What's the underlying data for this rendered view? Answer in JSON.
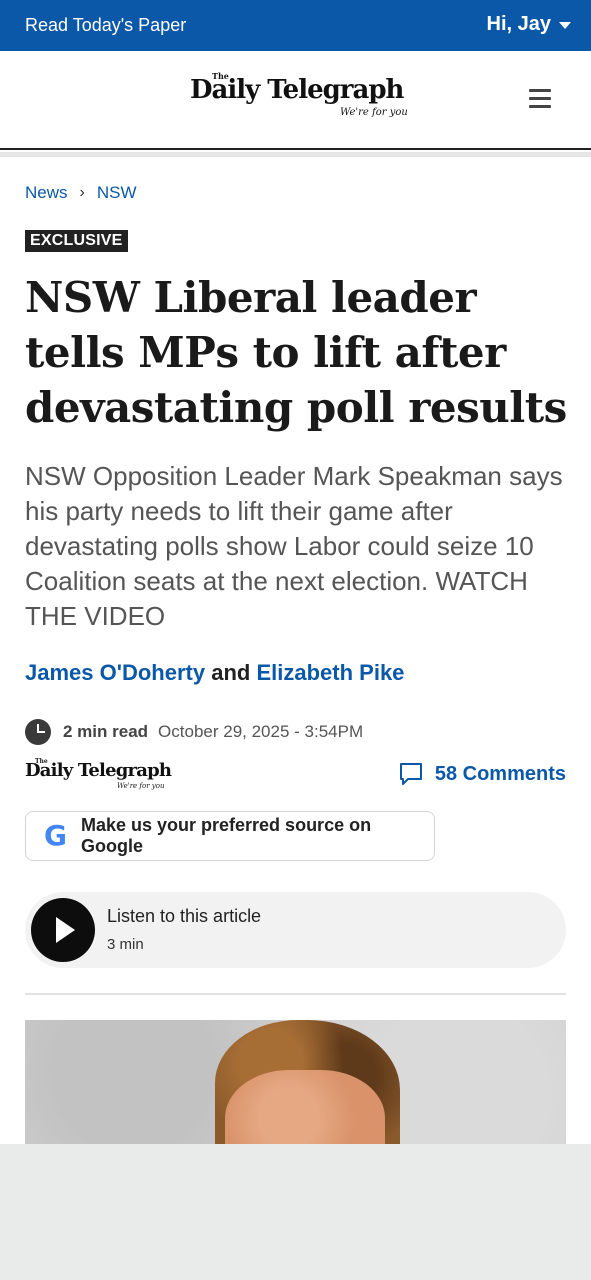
{
  "topbar": {
    "read_paper": "Read Today's Paper",
    "greeting": "Hi, Jay"
  },
  "masthead": {
    "logo_the": "The",
    "logo_name": "Daily Telegraph",
    "logo_tagline": "We're for you"
  },
  "breadcrumb": {
    "items": [
      "News",
      "NSW"
    ]
  },
  "article": {
    "badge": "EXCLUSIVE",
    "headline": "NSW Liberal leader tells MPs to lift after devastating poll results",
    "standfirst": "NSW Opposition Leader Mark Speakman says his party needs to lift their game after devastating polls show Labor could seize 10 Coalition seats at the next election. WATCH THE VIDEO",
    "authors": [
      "James O'Doherty",
      "Elizabeth Pike"
    ],
    "author_joiner": "and",
    "read_time": "2 min read",
    "date": "October 29, 2025 - 3:54PM",
    "comments": "58 Comments"
  },
  "google_cta": {
    "label": "Make us your preferred source on Google",
    "icon": "google-g-icon",
    "letter": "G"
  },
  "audio": {
    "title": "Listen to this article",
    "duration": "3 min"
  },
  "colors": {
    "brand_blue": "#0b58a8",
    "topbar_bg": "#0b58a8",
    "badge_bg": "#222222",
    "google_blue": "#4285F4",
    "google_red": "#EA4335",
    "google_yellow": "#FBBC05",
    "google_green": "#34A853"
  }
}
